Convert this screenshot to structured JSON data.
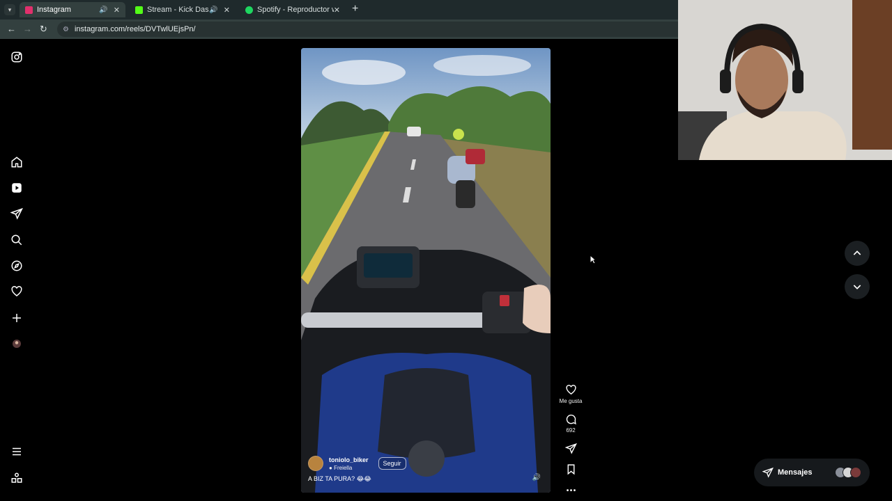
{
  "browser": {
    "tabs": [
      {
        "title": "Instagram",
        "active": true,
        "audio": true,
        "favicon_color": "#e1306c"
      },
      {
        "title": "Stream - Kick Dashboard",
        "active": false,
        "audio": true,
        "favicon_color": "#53fc18"
      },
      {
        "title": "Spotify - Reproductor web: mú",
        "active": false,
        "audio": false,
        "favicon_color": "#1ed760"
      }
    ],
    "url": "instagram.com/reels/DVTwlUEjsPn/"
  },
  "sidebar": {
    "items": [
      "instagram-logo",
      "home",
      "reels",
      "messages",
      "search",
      "explore",
      "notifications",
      "create",
      "profile",
      "more",
      "also-from-meta"
    ]
  },
  "reel": {
    "author": "toniolo_biker",
    "location": "Freiella",
    "follow_label": "Seguir",
    "caption": "A BIZ TA PURA? 😂😂",
    "actions": {
      "like_label": "Me gusta",
      "comment_count": "692"
    }
  },
  "messages": {
    "label": "Mensajes"
  },
  "colors": {
    "tabbar": "#1f2a2c",
    "toolbar": "#33403f",
    "page_bg": "#000000",
    "reel_sky": "#7ba0c8"
  }
}
